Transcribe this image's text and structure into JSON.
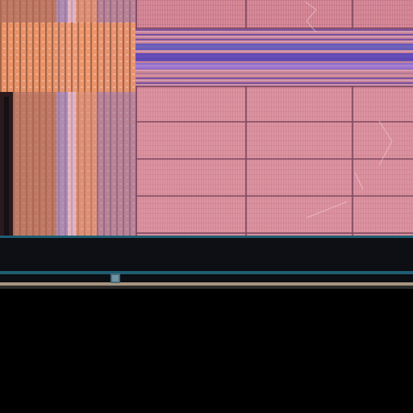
{
  "scene": {
    "subject": "die-micrograph",
    "colors": {
      "background": "#000000",
      "die_fill": "#d88a98",
      "die_fill_light": "#e4a3ad",
      "grid_line": "#7f4a62",
      "logic_orange": "#f09a6a",
      "logic_dark": "#6b3b3a",
      "bus_blue": "#5f5bbf",
      "bus_purple": "#8b6fd1",
      "edge_dark": "#0d0f14",
      "edge_teal": "#1f5d73",
      "edge_tan": "#b9a48d"
    }
  }
}
